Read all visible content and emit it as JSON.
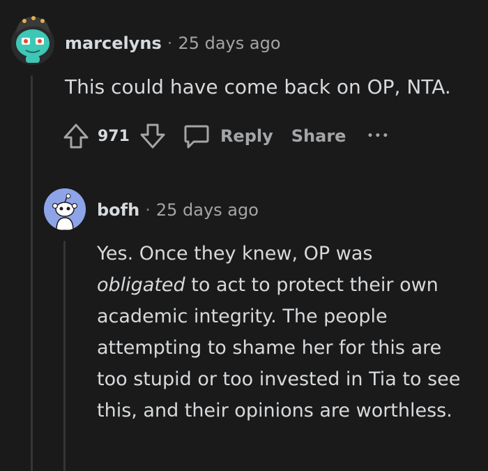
{
  "comment": {
    "username": "marcelyns",
    "separator": "·",
    "time": "25 days ago",
    "body": "This could have come back on OP, NTA.",
    "score": "971",
    "actions": {
      "reply": "Reply",
      "share": "Share",
      "more": "•••"
    },
    "avatar_icon": "snoo-avatar-teal"
  },
  "reply": {
    "username": "bofh",
    "separator": "·",
    "time": "25 days ago",
    "body_pre": "Yes. Once they knew, OP was",
    "body_em": "obligated",
    "body_post": " to act to protect their own academic integrity. The people attempting to shame her for this are too stupid or too invested in Tia to see this, and their opinions are worthless.",
    "avatar_icon": "default-snoo-avatar"
  },
  "colors": {
    "background": "#1a1a1b",
    "text": "#d7dadc",
    "muted": "#a3a5a7",
    "thread_line": "#343536",
    "avatar_blue": "#8ea4e8"
  }
}
